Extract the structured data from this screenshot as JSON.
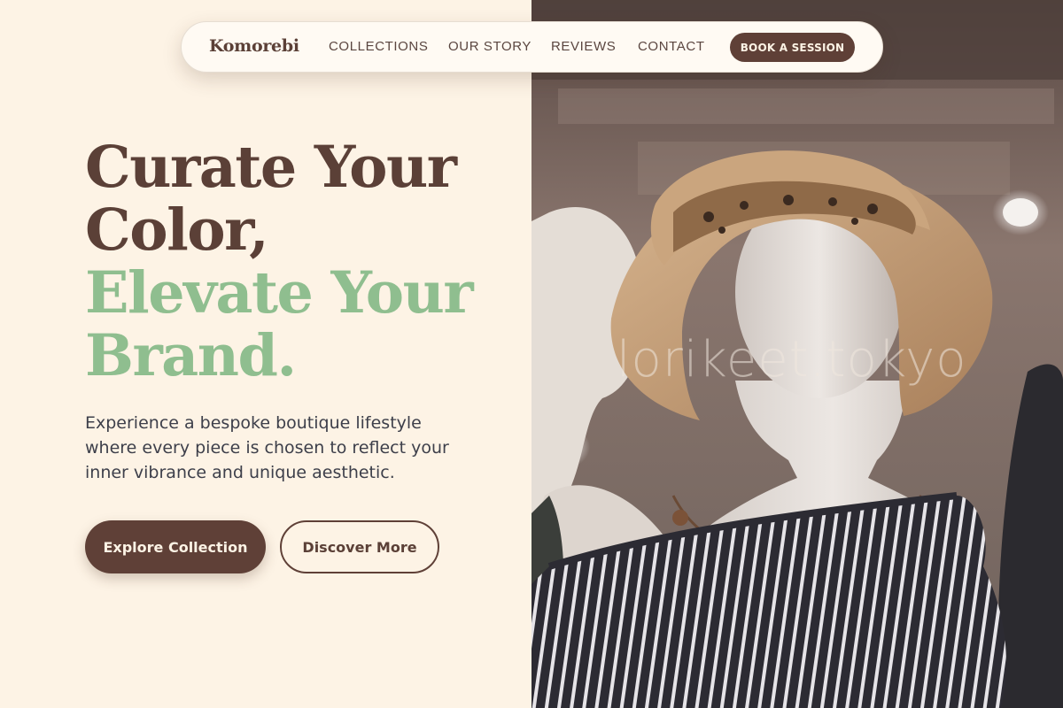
{
  "nav": {
    "brand": "Komorebi",
    "links": [
      "COLLECTIONS",
      "OUR STORY",
      "REVIEWS",
      "CONTACT"
    ],
    "cta": "BOOK A SESSION"
  },
  "hero": {
    "headline_line1": "Curate Your",
    "headline_line2": "Color,",
    "headline_line3": "Elevate Your",
    "headline_line4": "Brand.",
    "description": "Experience a bespoke boutique lifestyle where every piece is chosen to reflect your inner vibrance and unique aesthetic.",
    "primary_button": "Explore Collection",
    "secondary_button": "Discover More"
  },
  "image": {
    "watermark": "lorikeet.tokyo"
  },
  "colors": {
    "background": "#fdf3e5",
    "brand_brown": "#5f4037",
    "accent_green": "#8fbe8f",
    "body_text": "#3d3f4a"
  }
}
